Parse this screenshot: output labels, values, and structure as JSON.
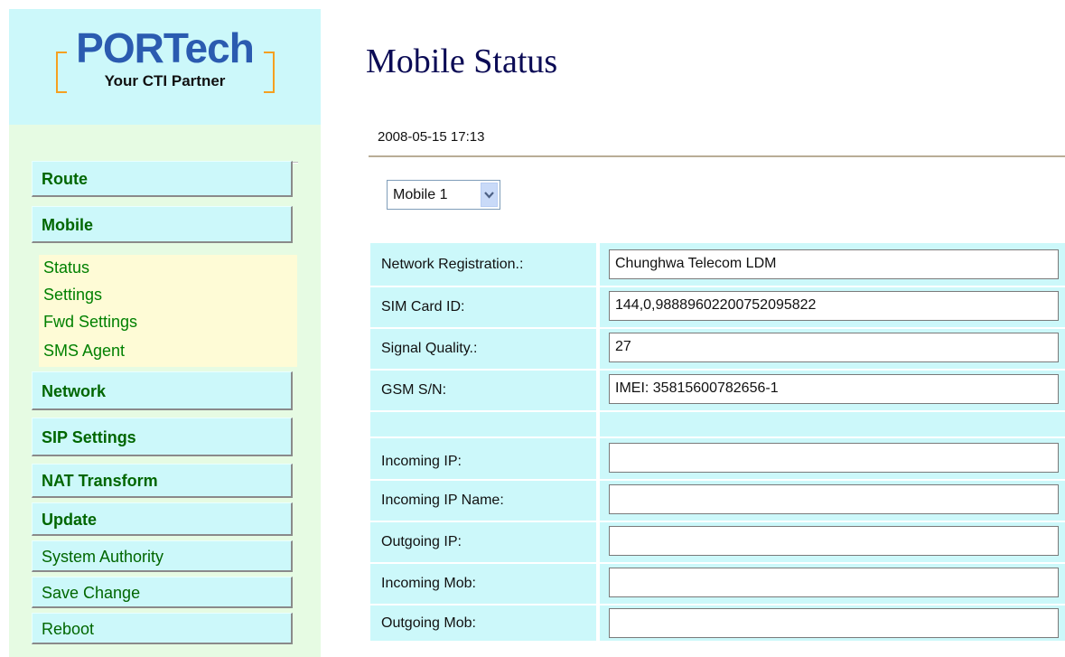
{
  "logo": {
    "title": "PORTech",
    "subtitle": "Your CTI Partner"
  },
  "nav": {
    "route": "Route",
    "mobile": "Mobile",
    "mobile_sub": [
      "Status",
      "Settings",
      "Fwd Settings",
      "SMS Agent"
    ],
    "network": "Network",
    "sip_settings": "SIP Settings",
    "nat_transform": "NAT Transform",
    "update": "Update",
    "system_authority": "System Authority",
    "save_change": "Save Change",
    "reboot": "Reboot"
  },
  "page": {
    "title": "Mobile Status",
    "timestamp": "2008-05-15 17:13",
    "mobile_select": {
      "selected": "Mobile 1"
    }
  },
  "status_rows": [
    {
      "label": "Network Registration.:",
      "value": "Chunghwa Telecom LDM"
    },
    {
      "label": "SIM Card ID:",
      "value": "144,0,98889602200752095822"
    },
    {
      "label": "Signal Quality.:",
      "value": "27"
    },
    {
      "label": "GSM S/N:",
      "value": "IMEI: 35815600782656-1"
    },
    {
      "label": "",
      "value": ""
    },
    {
      "label": "Incoming IP:",
      "value": ""
    },
    {
      "label": "Incoming IP Name:",
      "value": ""
    },
    {
      "label": "Outgoing IP:",
      "value": ""
    },
    {
      "label": "Incoming Mob:",
      "value": ""
    },
    {
      "label": "Outgoing Mob:",
      "value": ""
    }
  ],
  "colors": {
    "logo_blue": "#2b5bb0",
    "logo_bracket": "#f5a020",
    "sidebar_bg": "#e6fbe3",
    "cyan": "#ccf8fa",
    "nav_text": "#006600",
    "subitem_bg": "#fefbd6",
    "title_navy": "#0b0b55"
  },
  "icons": {
    "select_arrow": "chevron-down-icon"
  }
}
